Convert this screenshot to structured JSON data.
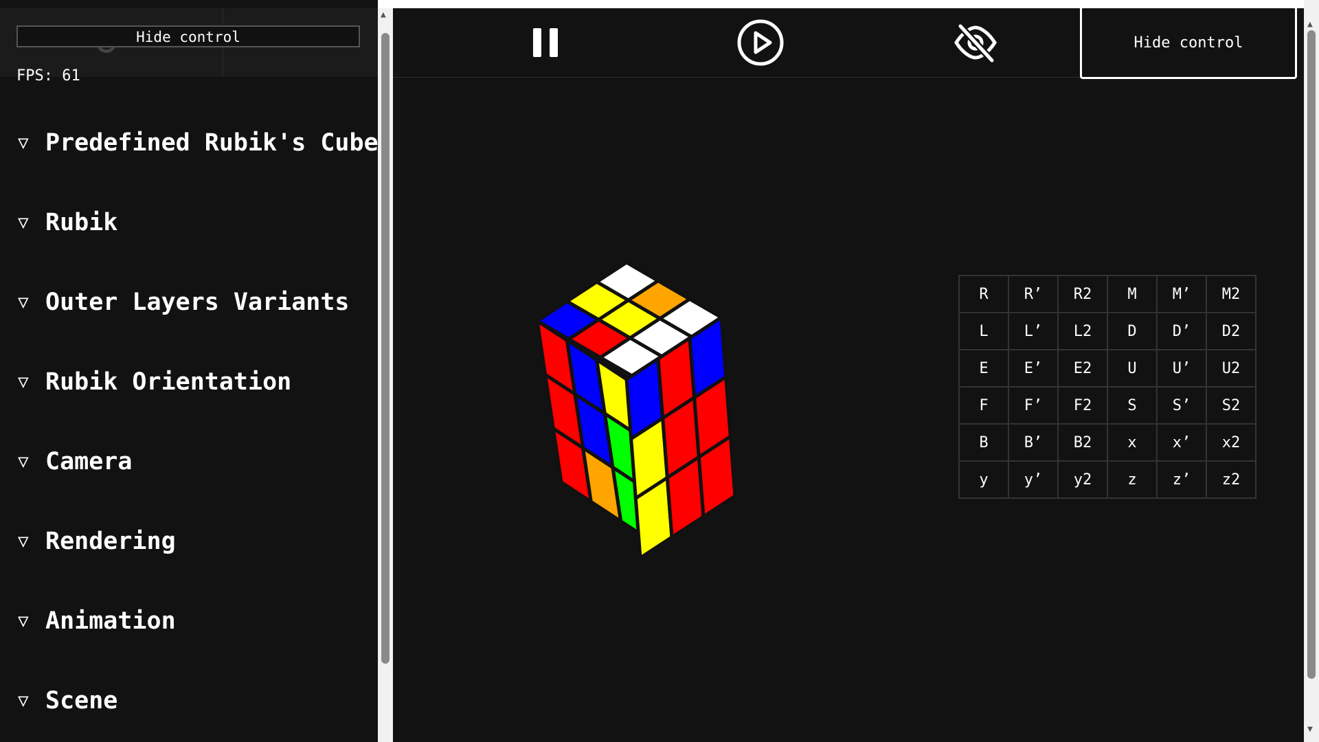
{
  "panel": {
    "hide_control_label": "Hide control",
    "fps_text": "FPS: 61",
    "sections": [
      {
        "label": "Predefined Rubik's Cube",
        "collapsed_icon": "▽"
      },
      {
        "label": "Rubik",
        "collapsed_icon": "▽"
      },
      {
        "label": "Outer Layers Variants",
        "collapsed_icon": "▽"
      },
      {
        "label": "Rubik Orientation",
        "collapsed_icon": "▽"
      },
      {
        "label": "Camera",
        "collapsed_icon": "▽"
      },
      {
        "label": "Rendering",
        "collapsed_icon": "▽"
      },
      {
        "label": "Animation",
        "collapsed_icon": "▽"
      },
      {
        "label": "Scene",
        "collapsed_icon": "▽"
      }
    ]
  },
  "toolbar": {
    "buttons": [
      {
        "icon": "pause-icon"
      },
      {
        "icon": "play-circle-icon"
      },
      {
        "icon": "eye-off-icon"
      }
    ],
    "hide_control_label": "Hide control"
  },
  "moves": {
    "rows": [
      [
        "R",
        "R’",
        "R2",
        "M",
        "M’",
        "M2"
      ],
      [
        "L",
        "L’",
        "L2",
        "D",
        "D’",
        "D2"
      ],
      [
        "E",
        "E’",
        "E2",
        "U",
        "U’",
        "U2"
      ],
      [
        "F",
        "F’",
        "F2",
        "S",
        "S’",
        "S2"
      ],
      [
        "B",
        "B’",
        "B2",
        "x",
        "x’",
        "x2"
      ],
      [
        "y",
        "y’",
        "y2",
        "z",
        "z’",
        "z2"
      ]
    ]
  },
  "cube": {
    "top_face": [
      [
        "white",
        "orange",
        "white"
      ],
      [
        "yellow",
        "yellow",
        "white"
      ],
      [
        "blue",
        "red",
        "white"
      ]
    ],
    "left_face": [
      [
        "red",
        "blue",
        "yellow"
      ],
      [
        "red",
        "blue",
        "green"
      ],
      [
        "red",
        "orange",
        "green"
      ]
    ],
    "right_face": [
      [
        "blue",
        "red",
        "blue"
      ],
      [
        "yellow",
        "red",
        "red"
      ],
      [
        "yellow",
        "red",
        "red"
      ]
    ],
    "colors": {
      "white": "#ffffff",
      "yellow": "#ffff00",
      "red": "#ff0000",
      "orange": "#ffa500",
      "blue": "#0000ff",
      "green": "#00ff00"
    }
  }
}
